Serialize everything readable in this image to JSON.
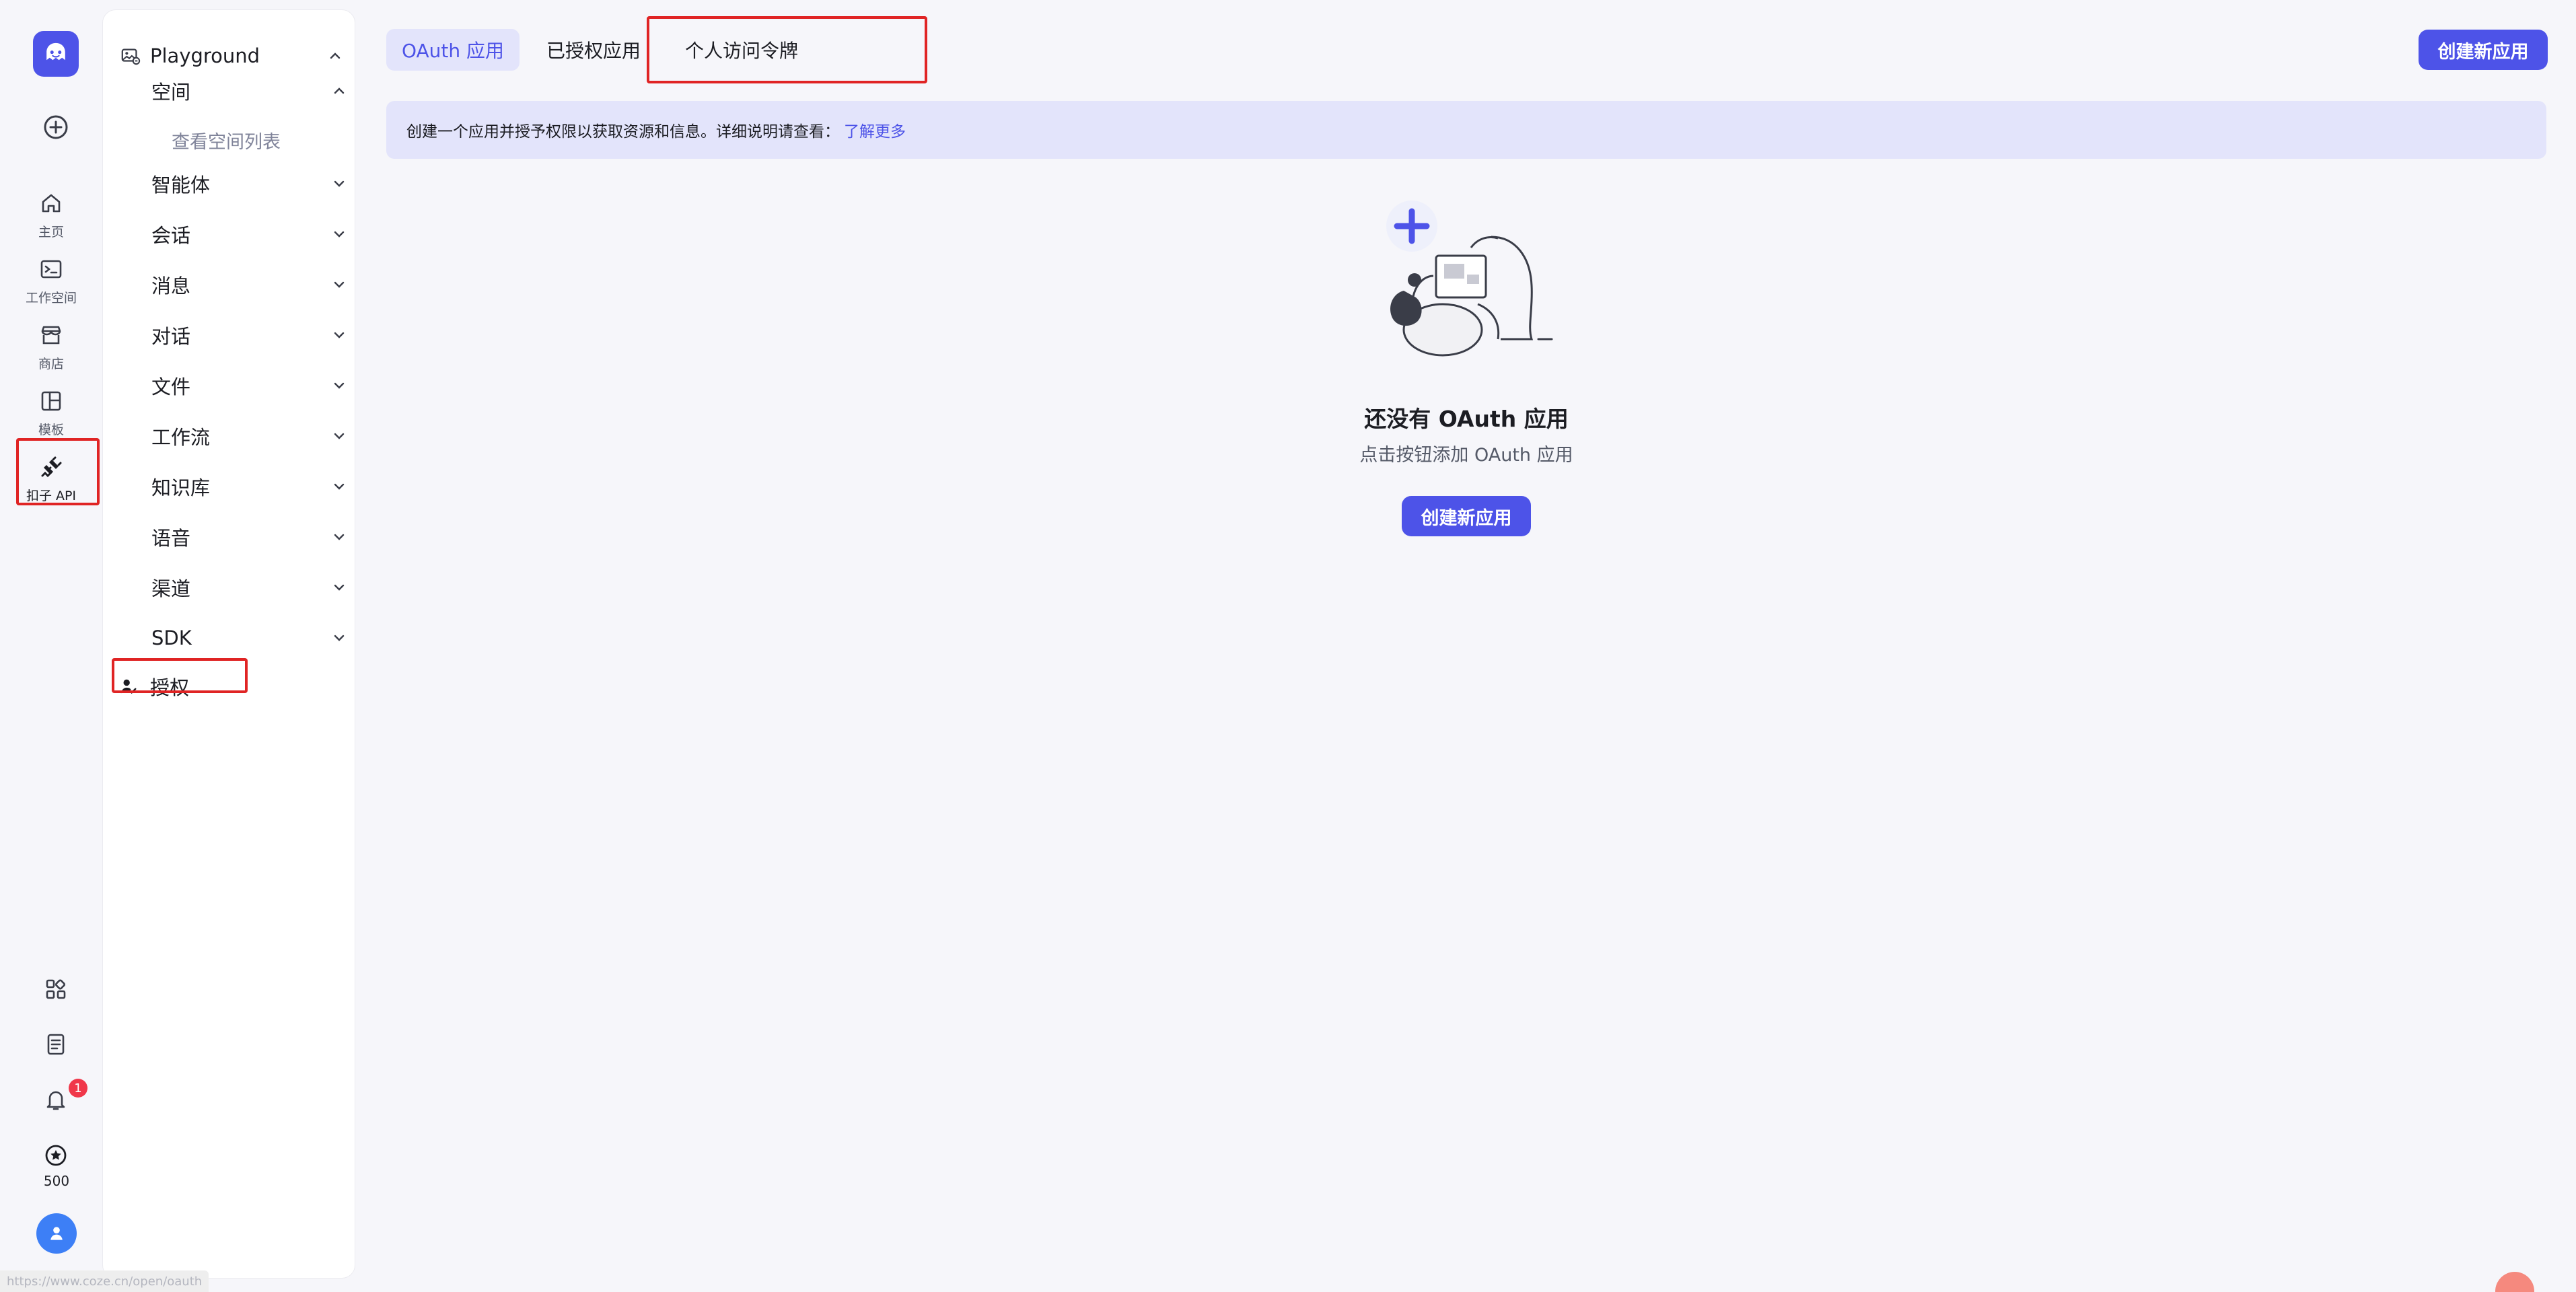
{
  "rail": {
    "items": [
      {
        "label": "主页",
        "icon": "home-icon"
      },
      {
        "label": "工作空间",
        "icon": "terminal-icon"
      },
      {
        "label": "商店",
        "icon": "store-icon"
      },
      {
        "label": "模板",
        "icon": "template-icon"
      },
      {
        "label": "扣子 API",
        "icon": "plug-icon"
      }
    ],
    "notification_count": "1",
    "credits": "500"
  },
  "nav": {
    "group_title": "Playground",
    "space_label": "空间",
    "space_sub_item": "查看空间列表",
    "items": [
      "智能体",
      "会话",
      "消息",
      "对话",
      "文件",
      "工作流",
      "知识库",
      "语音",
      "渠道",
      "SDK"
    ],
    "auth_label": "授权"
  },
  "tabs": {
    "oauth": "OAuth 应用",
    "authorized": "已授权应用",
    "pat": "个人访问令牌"
  },
  "header": {
    "create_label": "创建新应用"
  },
  "banner": {
    "text": "创建一个应用并授予权限以获取资源和信息。详细说明请查看：",
    "link": "了解更多"
  },
  "empty_state": {
    "title": "还没有 OAuth 应用",
    "description": "点击按钮添加 OAuth 应用",
    "button_label": "创建新应用"
  },
  "status_bar": {
    "url": "https://www.coze.cn/open/oauth"
  },
  "colors": {
    "accent": "#4d53e8",
    "accent_soft": "#e3e4fb",
    "background": "#f6f6fa",
    "annotation": "#e02424",
    "badge": "#f0374a"
  }
}
